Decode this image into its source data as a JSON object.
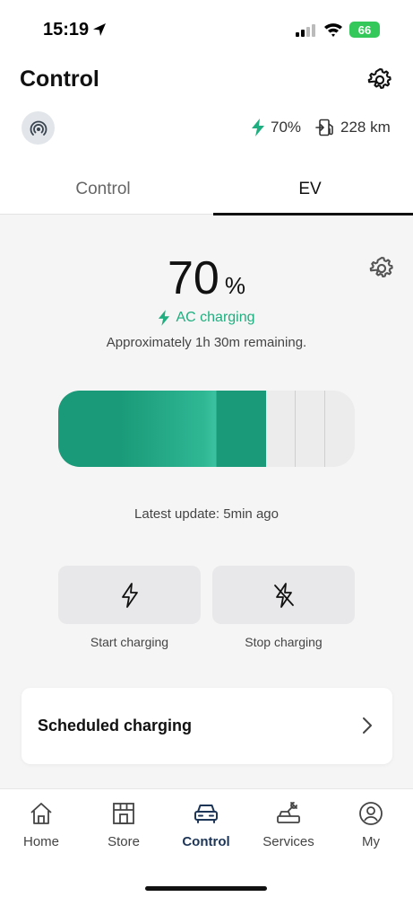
{
  "status_bar": {
    "time": "15:19",
    "battery": "66"
  },
  "header": {
    "title": "Control"
  },
  "vehicle": {
    "charge": "70%",
    "range": "228 km"
  },
  "tabs": [
    {
      "label": "Control",
      "active": false
    },
    {
      "label": "EV",
      "active": true
    }
  ],
  "ev": {
    "soc_value": "70",
    "soc_unit": "%",
    "charge_status": "AC charging",
    "remaining": "Approximately 1h 30m remaining.",
    "battery_level": 0.7,
    "latest_update": "Latest update: 5min ago",
    "start_label": "Start charging",
    "stop_label": "Stop charging",
    "scheduled_label": "Scheduled charging"
  },
  "bottom_nav": [
    {
      "label": "Home",
      "icon": "home-icon",
      "active": false
    },
    {
      "label": "Store",
      "icon": "store-icon",
      "active": false
    },
    {
      "label": "Control",
      "icon": "car-icon",
      "active": true
    },
    {
      "label": "Services",
      "icon": "services-icon",
      "active": false
    },
    {
      "label": "My",
      "icon": "profile-icon",
      "active": false
    }
  ],
  "colors": {
    "accent_green": "#1fae7f",
    "battery_fill": "#1a9a78",
    "nav_active": "#1d3557"
  }
}
